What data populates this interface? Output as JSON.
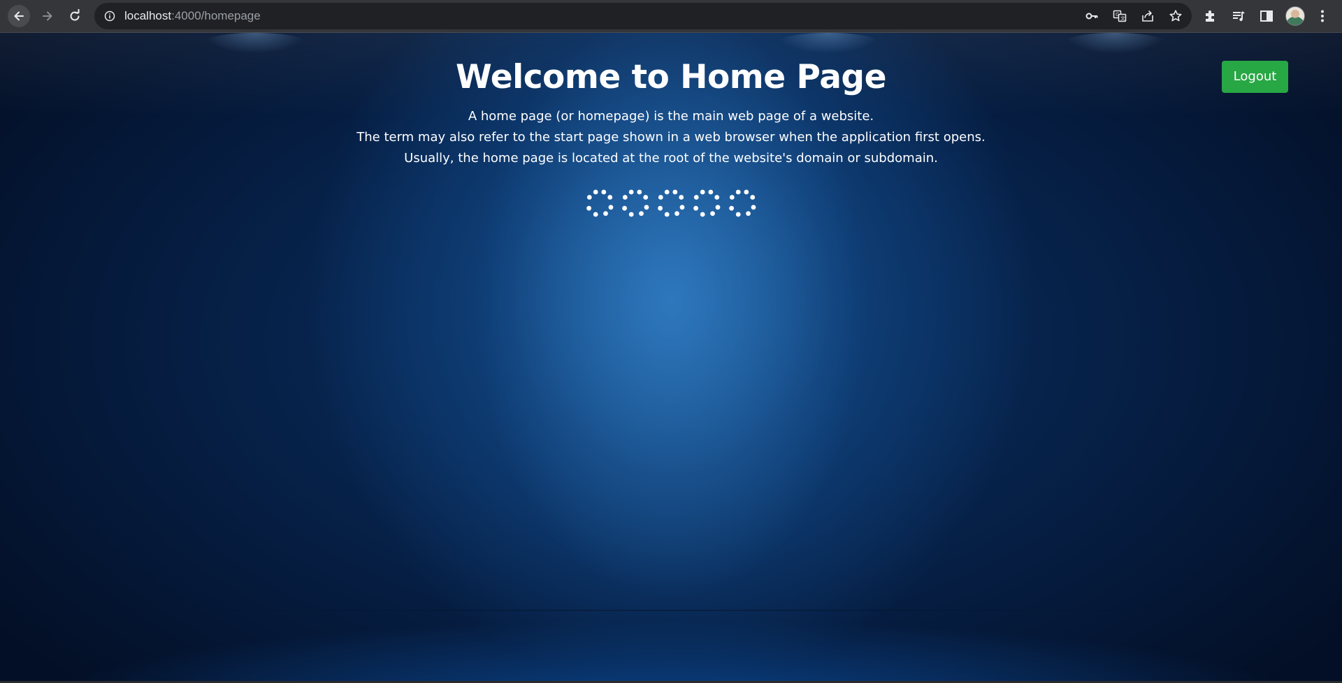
{
  "browser": {
    "url_host": "localhost",
    "url_path": ":4000/homepage",
    "toolbar_icons": [
      "key-icon",
      "translate-icon",
      "share-icon",
      "star-icon",
      "extensions-icon",
      "reading-list-icon",
      "side-panel-icon",
      "profile-avatar",
      "menu-icon"
    ]
  },
  "page": {
    "title": "Welcome to Home Page",
    "description": [
      "A home page (or homepage) is the main web page of a website.",
      "The term may also refer to the start page shown in a web browser when the application first opens.",
      "Usually, the home page is located at the root of the website's domain or subdomain."
    ],
    "logout_label": "Logout",
    "loader_count": 5,
    "colors": {
      "logout_button": "#28a745",
      "background_center": "#1d5fa3",
      "background_edge": "#030f26",
      "text": "#ffffff"
    }
  }
}
